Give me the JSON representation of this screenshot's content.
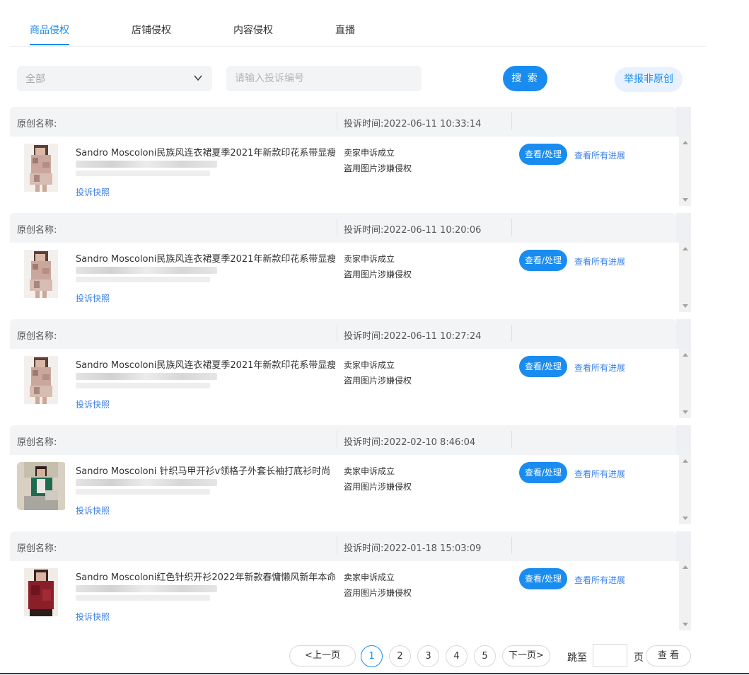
{
  "tabs": [
    {
      "label": "商品侵权",
      "active": true
    },
    {
      "label": "店铺侵权",
      "active": false
    },
    {
      "label": "内容侵权",
      "active": false
    },
    {
      "label": "直播",
      "active": false
    }
  ],
  "filter": {
    "select_value": "全部",
    "search_placeholder": "请输入投诉编号",
    "search_button": "搜 索",
    "report_button": "举报非原创"
  },
  "records": [
    {
      "original_label": "原创名称:",
      "time": "投诉时间:2022-06-11 10:33:14",
      "title": "Sandro Moscoloni民族风连衣裙夏季2021年新款印花系带显瘦",
      "snapshot": "投诉快照",
      "status": "卖家申诉成立",
      "reason": "盗用图片涉嫌侵权",
      "view_button": "查看/处理",
      "progress_link": "查看所有进展",
      "thumb": "dress"
    },
    {
      "original_label": "原创名称:",
      "time": "投诉时间:2022-06-11 10:20:06",
      "title": "Sandro Moscoloni民族风连衣裙夏季2021年新款印花系带显瘦",
      "snapshot": "投诉快照",
      "status": "卖家申诉成立",
      "reason": "盗用图片涉嫌侵权",
      "view_button": "查看/处理",
      "progress_link": "查看所有进展",
      "thumb": "dress"
    },
    {
      "original_label": "原创名称:",
      "time": "投诉时间:2022-06-11 10:27:24",
      "title": "Sandro Moscoloni民族风连衣裙夏季2021年新款印花系带显瘦",
      "snapshot": "投诉快照",
      "status": "卖家申诉成立",
      "reason": "盗用图片涉嫌侵权",
      "view_button": "查看/处理",
      "progress_link": "查看所有进展",
      "thumb": "dress"
    },
    {
      "original_label": "原创名称:",
      "time": "投诉时间:2022-02-10 8:46:04",
      "title": "Sandro Moscoloni 针织马甲开衫v领格子外套长袖打底衫时尚",
      "snapshot": "投诉快照",
      "status": "卖家申诉成立",
      "reason": "盗用图片涉嫌侵权",
      "view_button": "查看/处理",
      "progress_link": "查看所有进展",
      "thumb": "sweater"
    },
    {
      "original_label": "原创名称:",
      "time": "投诉时间:2022-01-18 15:03:09",
      "title": "Sandro Moscoloni红色针织开衫2022年新款春慵懒风新年本命年",
      "snapshot": "投诉快照",
      "status": "卖家申诉成立",
      "reason": "盗用图片涉嫌侵权",
      "view_button": "查看/处理",
      "progress_link": "查看所有进展",
      "thumb": "red"
    }
  ],
  "pagination": {
    "prev": "<上一页",
    "pages": [
      "1",
      "2",
      "3",
      "4",
      "5"
    ],
    "current": "1",
    "next": "下一页>",
    "jump_label": "跳至",
    "page_unit": "页",
    "go_button": "查 看"
  },
  "colors": {
    "accent": "#1a8cf0",
    "link": "#3a7fe6",
    "row_header_bg": "#f3f4f6"
  }
}
